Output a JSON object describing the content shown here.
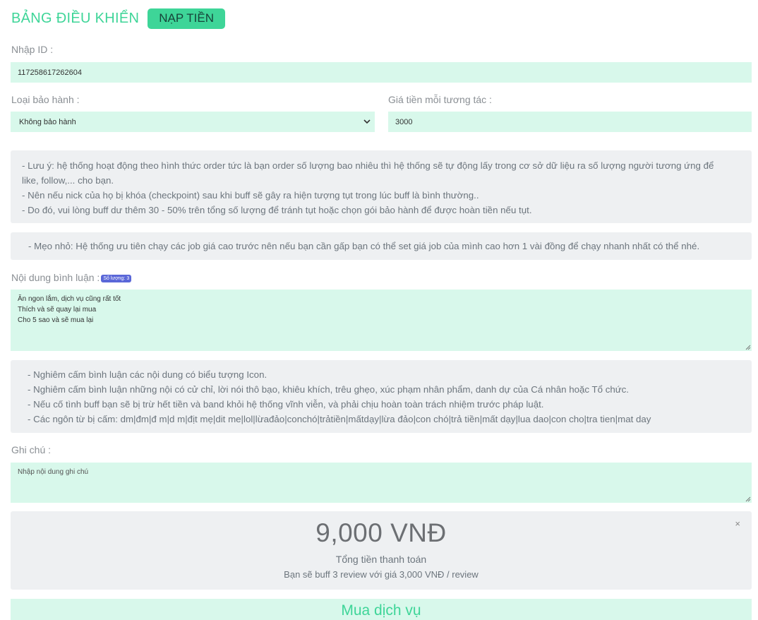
{
  "header": {
    "title": "BẢNG ĐIỀU KHIỂN",
    "topup_label": "NẠP TIỀN"
  },
  "id_field": {
    "label": "Nhập ID :",
    "value": "117258617262604"
  },
  "warranty": {
    "label": "Loại bảo hành :",
    "value": "Không bảo hành"
  },
  "price": {
    "label": "Giá tiền mỗi tương tác :",
    "value": "3000"
  },
  "notice1": [
    "- Lưu ý: hệ thống hoạt động theo hình thức order tức là bạn order số lượng bao nhiêu thì hệ thống sẽ tự động lấy trong cơ sở dữ liệu ra số lượng người tương ứng để",
    "like, follow,... cho bạn.",
    "- Nên nếu nick của họ bị khóa (checkpoint) sau khi buff sẽ gây ra hiện tượng tụt trong lúc buff là bình thường..",
    "- Do đó, vui lòng buff dư thêm 30 - 50% trên tổng số lượng để tránh tụt hoặc chọn gói bảo hành để được hoàn tiền nếu tụt."
  ],
  "tip": "- Mẹo nhỏ: Hệ thống ưu tiên chạy các job giá cao trước nên nếu bạn cần gấp bạn có thể set giá job của mình cao hơn 1 vài đồng để chạy nhanh nhất có thể nhé.",
  "comments": {
    "label": "Nội dung bình luận :",
    "count_badge": "Số lượng: 3",
    "lines": [
      "Ăn ngon lắm, dịch vụ cũng rất tốt",
      "Thích và sẽ quay lại mua",
      "Cho 5 sao và sẽ mua lại"
    ]
  },
  "notice2": [
    "- Nghiêm cấm bình luận các nội dung có biểu tượng Icon.",
    "- Nghiêm cấm bình luận những nội có cử chỉ, lời nói thô bạo, khiêu khích, trêu ghẹo, xúc phạm nhân phẩm, danh dự của Cá nhân hoặc Tổ chức.",
    "- Nếu cố tình buff bạn sẽ bị trừ hết tiền và band khỏi hệ thống vĩnh viễn, và phải chịu hoàn toàn trách nhiệm trước pháp luật.",
    "- Các ngôn từ bị cấm: dm|đm|đ m|d m|địt mẹ|dit me|lol|lừađảo|conchó|trảtiền|mấtdạy|lừa đảo|con chó|trả tiền|mất dạy|lua dao|con cho|tra tien|mat day"
  ],
  "note": {
    "label": "Ghi chú :",
    "placeholder": "Nhập nội dung ghi chú"
  },
  "total": {
    "amount": "9,000 VNĐ",
    "caption": "Tổng tiền thanh toán",
    "detail": "Bạn sẽ buff 3 review với giá 3,000 VNĐ / review",
    "close": "×"
  },
  "buy_label": "Mua dịch vụ",
  "colors": {
    "accent": "#3ed598",
    "field_bg": "#d8f8eb",
    "notice_bg": "#eef0f2",
    "badge": "#5a67d8"
  }
}
